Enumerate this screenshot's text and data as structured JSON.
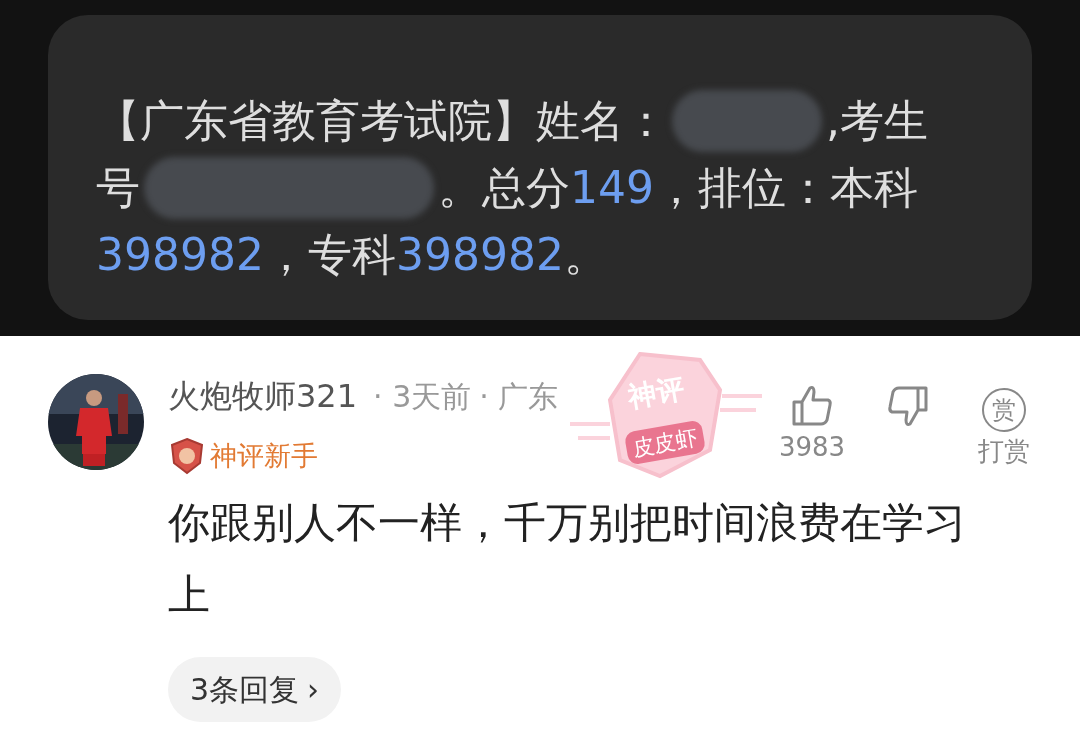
{
  "sms_card": {
    "lines": [
      [
        {
          "kind": "text",
          "text": "【广东省教育考试院】姓名："
        },
        {
          "kind": "redacted"
        },
        {
          "kind": "text",
          "text": ",考生"
        }
      ],
      [
        {
          "kind": "text",
          "text": "号"
        },
        {
          "kind": "redacted"
        },
        {
          "kind": "text",
          "text": "。总分"
        },
        {
          "kind": "number",
          "text": "149"
        },
        {
          "kind": "text",
          "text": "，排位：本科"
        }
      ],
      [
        {
          "kind": "number",
          "text": "398982"
        },
        {
          "kind": "text",
          "text": "，专科"
        },
        {
          "kind": "number",
          "text": "398982"
        },
        {
          "kind": "text",
          "text": "。"
        }
      ]
    ]
  },
  "comment": {
    "username": "火炮牧师321",
    "time": "· 3天前",
    "location": "· 广东",
    "badge": "神评新手",
    "stamp": {
      "top": "神评",
      "bottom": "皮皮虾"
    },
    "like_count": "3983",
    "reward_glyph": "赏",
    "reward_label": "打赏",
    "text": "你跟别人不一样，千万别把时间浪费在学习上",
    "replies": "3条回复",
    "replies_arrow": "›"
  }
}
